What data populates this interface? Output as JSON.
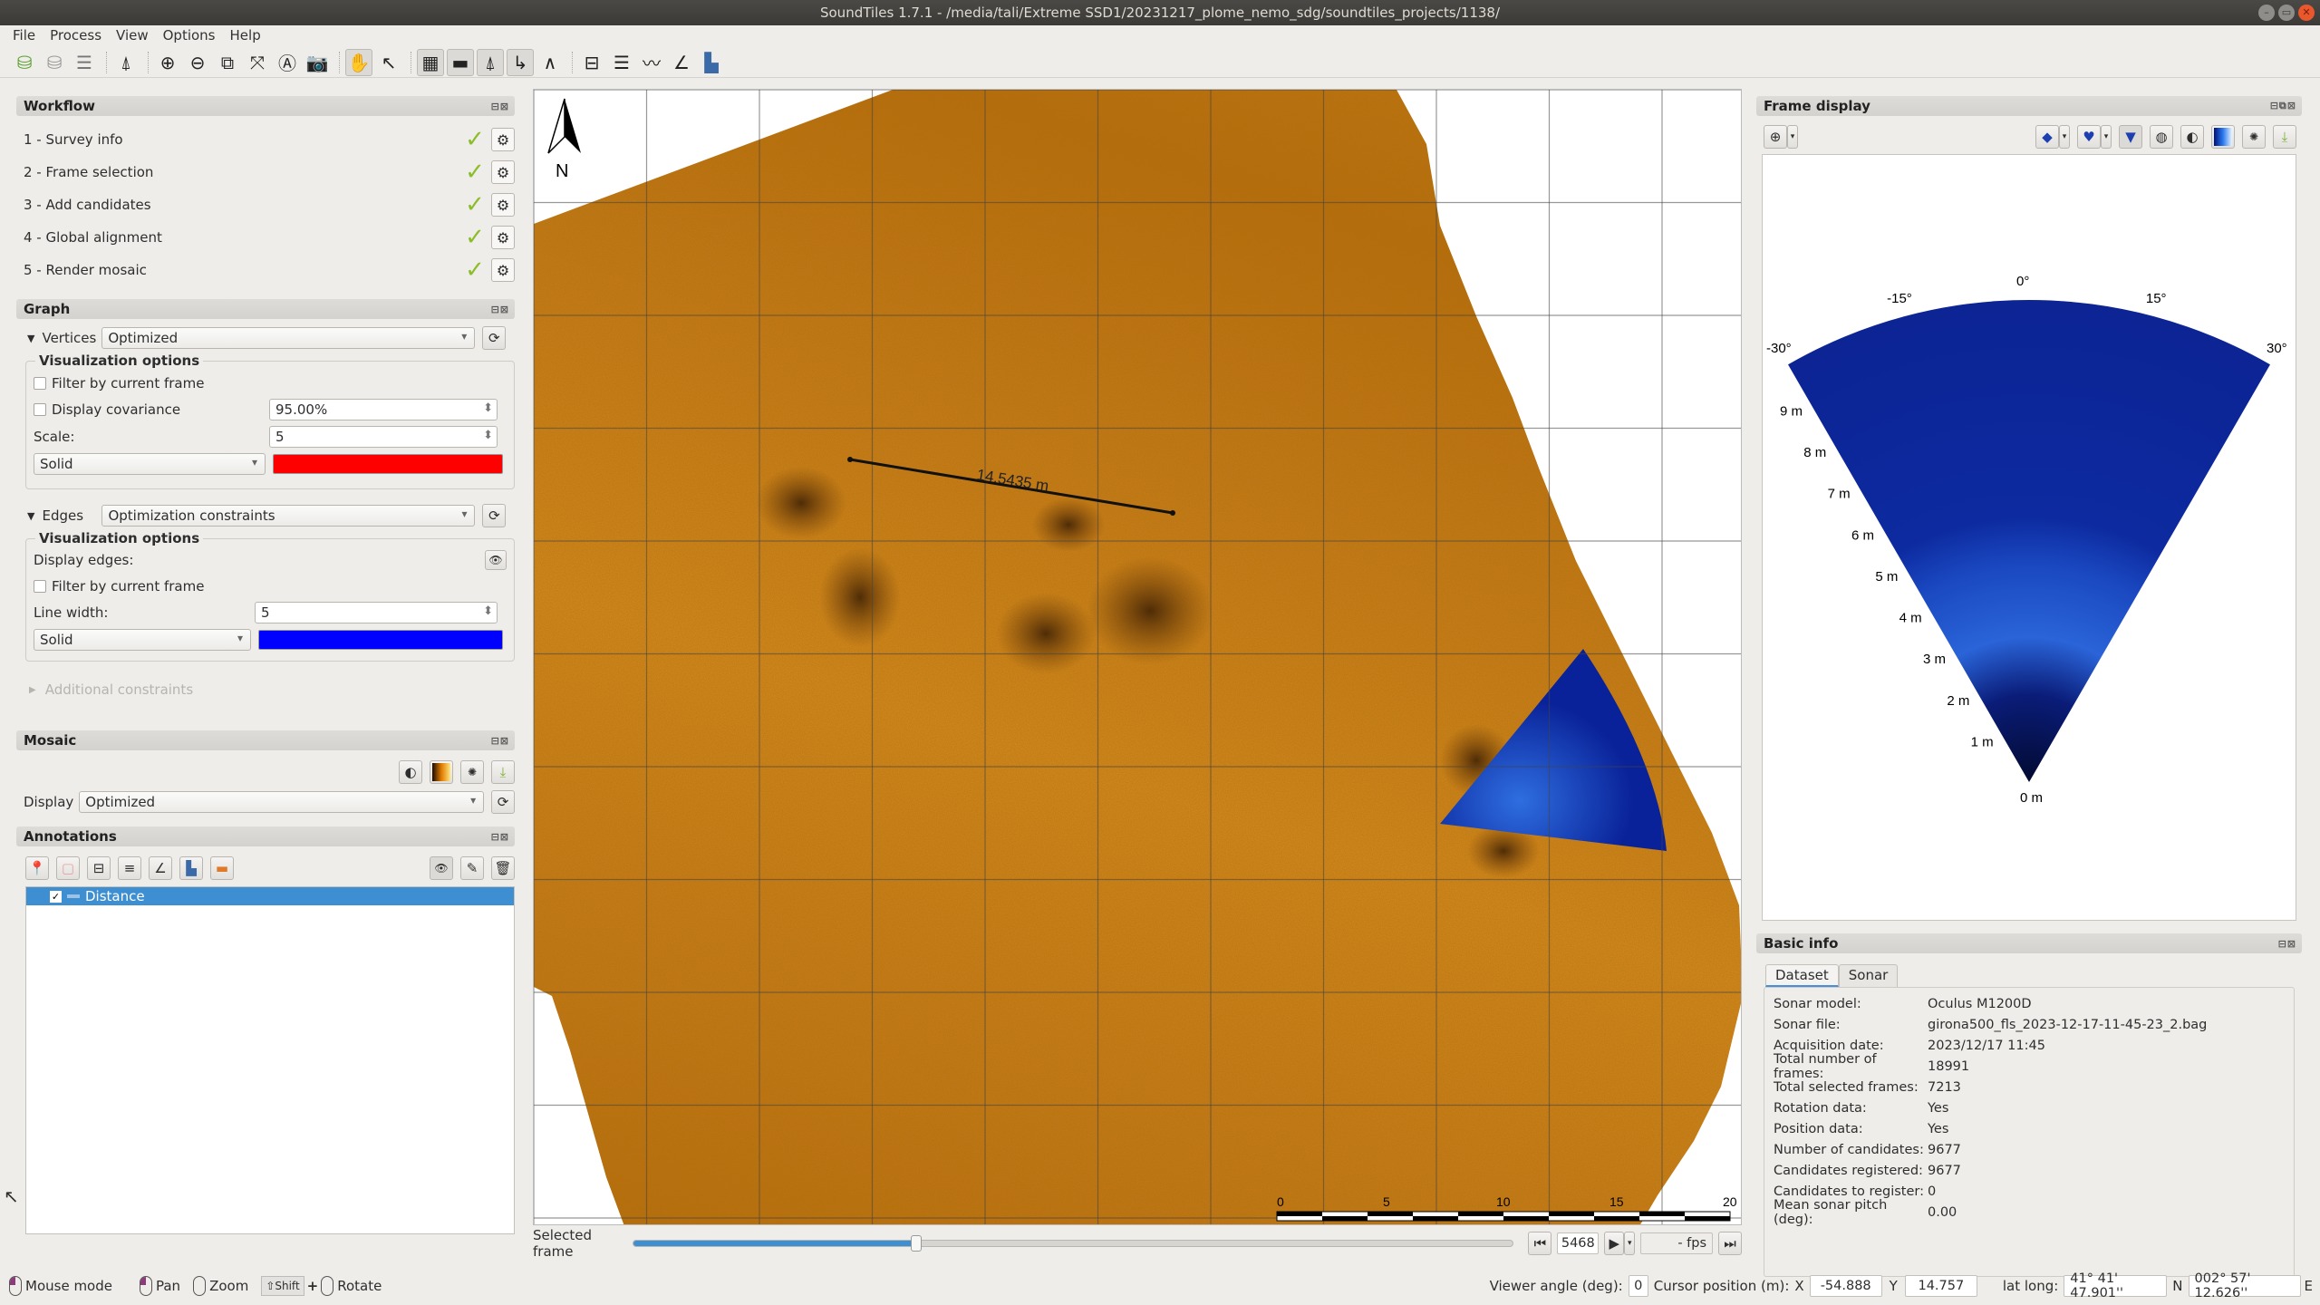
{
  "window": {
    "title": "SoundTiles 1.7.1 - /media/tali/Extreme SSD1/20231217_plome_nemo_sdg/soundtiles_projects/1138/"
  },
  "menu": [
    "File",
    "Process",
    "View",
    "Options",
    "Help"
  ],
  "toolbar": {
    "groups": [
      [
        "new-dataset",
        "open-dataset",
        "dataset-list"
      ],
      [
        "north-arrow-tool"
      ],
      [
        "zoom-in",
        "zoom-out",
        "zoom-selection",
        "fit-view",
        "zoom-reset",
        "screenshot"
      ],
      [
        "pan-mode",
        "select-mode"
      ],
      [
        "grid",
        "scale-bar",
        "north-indicator",
        "axes-indicator",
        "north-only"
      ],
      [
        "distance-measure",
        "area-measure",
        "profile-measure",
        "angle-measure",
        "height-measure"
      ]
    ],
    "active": [
      "pan-mode",
      "grid",
      "scale-bar",
      "north-indicator",
      "axes-indicator"
    ]
  },
  "workflow": {
    "title": "Workflow",
    "steps": [
      {
        "label": "1 - Survey info",
        "done": true
      },
      {
        "label": "2 - Frame selection",
        "done": true
      },
      {
        "label": "3 - Add candidates",
        "done": true
      },
      {
        "label": "4 - Global alignment",
        "done": true
      },
      {
        "label": "5 - Render mosaic",
        "done": true
      }
    ]
  },
  "graph": {
    "title": "Graph",
    "vertices": {
      "label": "Vertices",
      "selected": "Optimized",
      "vis_title": "Visualization options",
      "filter_label": "Filter by current frame",
      "filter_checked": false,
      "covariance_label": "Display covariance",
      "covariance_checked": false,
      "covariance_value": "95.00%",
      "scale_label": "Scale:",
      "scale_value": "5",
      "style": "Solid",
      "color": "#ff0000"
    },
    "edges": {
      "label": "Edges",
      "selected": "Optimization constraints",
      "vis_title": "Visualization options",
      "display_label": "Display edges:",
      "filter_label": "Filter by current frame",
      "filter_checked": false,
      "linewidth_label": "Line width:",
      "linewidth_value": "5",
      "style": "Solid",
      "color": "#0000ff"
    },
    "additional_label": "Additional constraints"
  },
  "mosaic": {
    "title": "Mosaic",
    "display_label": "Display",
    "display_value": "Optimized"
  },
  "annotations": {
    "title": "Annotations",
    "items": [
      {
        "label": "Distance",
        "checked": true,
        "selected": true
      }
    ]
  },
  "viewer": {
    "north_label": "N",
    "measure_label": "14.5435 m",
    "scale_ticks": [
      "0",
      "5",
      "10",
      "15",
      "20"
    ],
    "colors": {
      "mosaic": "#c97a1a",
      "sonar": "#0a2aa8",
      "grid": "#444444"
    }
  },
  "frame_display": {
    "title": "Frame display",
    "angle_labels": [
      "-30°",
      "-15°",
      "0°",
      "15°",
      "30°"
    ],
    "range_labels": [
      "0 m",
      "1 m",
      "2 m",
      "3 m",
      "4 m",
      "5 m",
      "6 m",
      "7 m",
      "8 m",
      "9 m"
    ]
  },
  "basic_info": {
    "title": "Basic info",
    "tabs": [
      "Dataset",
      "Sonar"
    ],
    "active_tab": "Dataset",
    "rows": [
      {
        "k": "Sonar model:",
        "v": "Oculus M1200D"
      },
      {
        "k": "Sonar file:",
        "v": "girona500_fls_2023-12-17-11-45-23_2.bag"
      },
      {
        "k": "Acquisition date:",
        "v": "2023/12/17 11:45"
      },
      {
        "k": "Total number of frames:",
        "v": "18991"
      },
      {
        "k": "Total selected frames:",
        "v": "7213"
      },
      {
        "k": "Rotation data:",
        "v": "Yes"
      },
      {
        "k": "Position data:",
        "v": "Yes"
      },
      {
        "k": "Number of candidates:",
        "v": "9677"
      },
      {
        "k": "Candidates registered:",
        "v": "9677"
      },
      {
        "k": "Candidates to register:",
        "v": "0"
      },
      {
        "k": "Mean sonar pitch (deg):",
        "v": "0.00"
      }
    ]
  },
  "frame_bar": {
    "label": "Selected frame",
    "progress": 0.322,
    "frame": "5468",
    "fps": "- fps"
  },
  "status": {
    "mouse_mode": "Mouse mode",
    "pan": "Pan",
    "zoom": "Zoom",
    "shift": "Shift",
    "rotate": "Rotate",
    "viewer_angle_label": "Viewer angle (deg):",
    "viewer_angle": "0",
    "cursor_label": "Cursor position (m):",
    "x_label": "X",
    "x": "-54.888",
    "y_label": "Y",
    "y": "14.757",
    "latlong_label": "lat long:",
    "lat": "41° 41' 47.901''",
    "lat_hemi": "N",
    "lon": "002° 57' 12.626''",
    "lon_hemi": "E"
  }
}
